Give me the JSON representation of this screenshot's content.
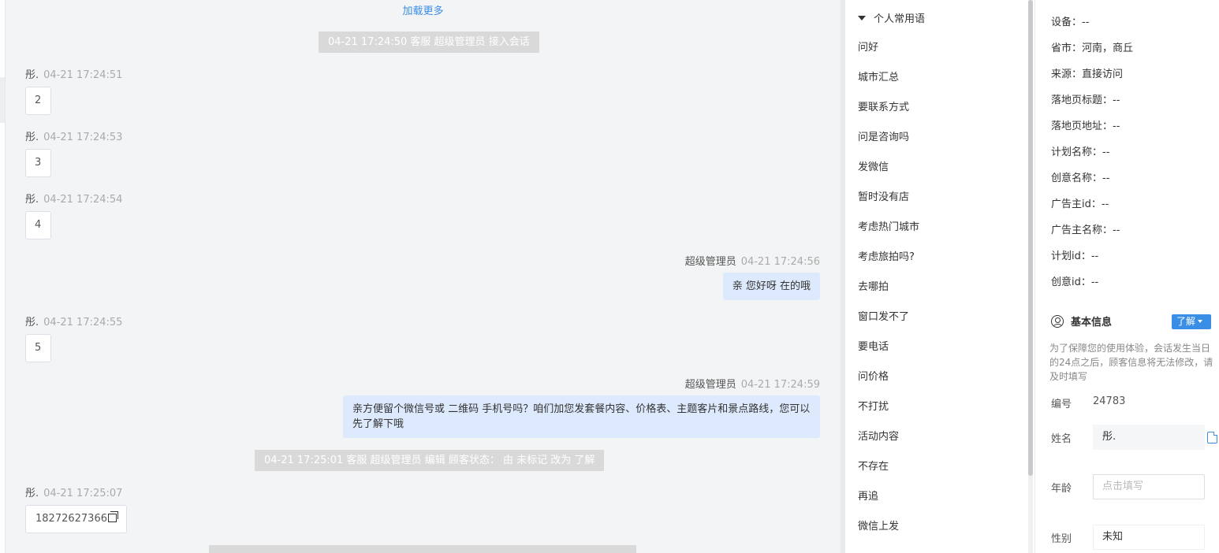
{
  "chat": {
    "load_more": "加载更多",
    "system_messages": [
      "04-21 17:24:50 客服 超级管理员 接入会话",
      "04-21 17:25:01 客服 超级管理员 编辑 顾客状态： 由 未标记 改为 了解"
    ],
    "messages": [
      {
        "sender": "彤.",
        "time": "04-21 17:24:51",
        "text": "2"
      },
      {
        "sender": "彤.",
        "time": "04-21 17:24:53",
        "text": "3"
      },
      {
        "sender": "彤.",
        "time": "04-21 17:24:54",
        "text": "4"
      },
      {
        "sender": "超级管理员",
        "time": "04-21 17:24:56",
        "text": "亲 您好呀 在的哦"
      },
      {
        "sender": "彤.",
        "time": "04-21 17:24:55",
        "text": "5"
      },
      {
        "sender": "超级管理员",
        "time": "04-21 17:24:59",
        "text": "亲方便留个微信号或 二维码 手机号吗？咱们加您发套餐内容、价格表、主题客片和景点路线，您可以先了解下哦"
      },
      {
        "sender": "彤.",
        "time": "04-21 17:25:07",
        "text": "18272627366"
      }
    ]
  },
  "phrases": {
    "group_title": "个人常用语",
    "items": [
      "问好",
      "城市汇总",
      "要联系方式",
      "问是咨询吗",
      "发微信",
      "暂时没有店",
      "考虑热门城市",
      "考虑旅拍吗?",
      "去哪拍",
      "窗口发不了",
      "要电话",
      "问价格",
      "不打扰",
      "活动内容",
      "不存在",
      "再追",
      "微信上发"
    ]
  },
  "info": {
    "rows": [
      "设备：--",
      "省市：河南，商丘",
      "来源：直接访问",
      "落地页标题：--",
      "落地页地址：--",
      "计划名称：--",
      "创意名称：--",
      "广告主id：--",
      "广告主名称：--",
      "计划id：--",
      "创意id：--"
    ],
    "section_title": "基本信息",
    "tag_label": "了解",
    "notice": "为了保障您的使用体验，会话发生当日的24点之后，顾客信息将无法修改，请及时填写",
    "id_label": "编号",
    "id_value": "24783",
    "name_label": "姓名",
    "name_value": "彤.",
    "age_label": "年龄",
    "age_placeholder": "点击填写",
    "gender_label": "性别",
    "gender_value": "未知"
  },
  "colors": {
    "accent": "#3a8ee6",
    "outgoing_bubble": "#dde9fc",
    "system_pill": "#d9d9d9"
  }
}
